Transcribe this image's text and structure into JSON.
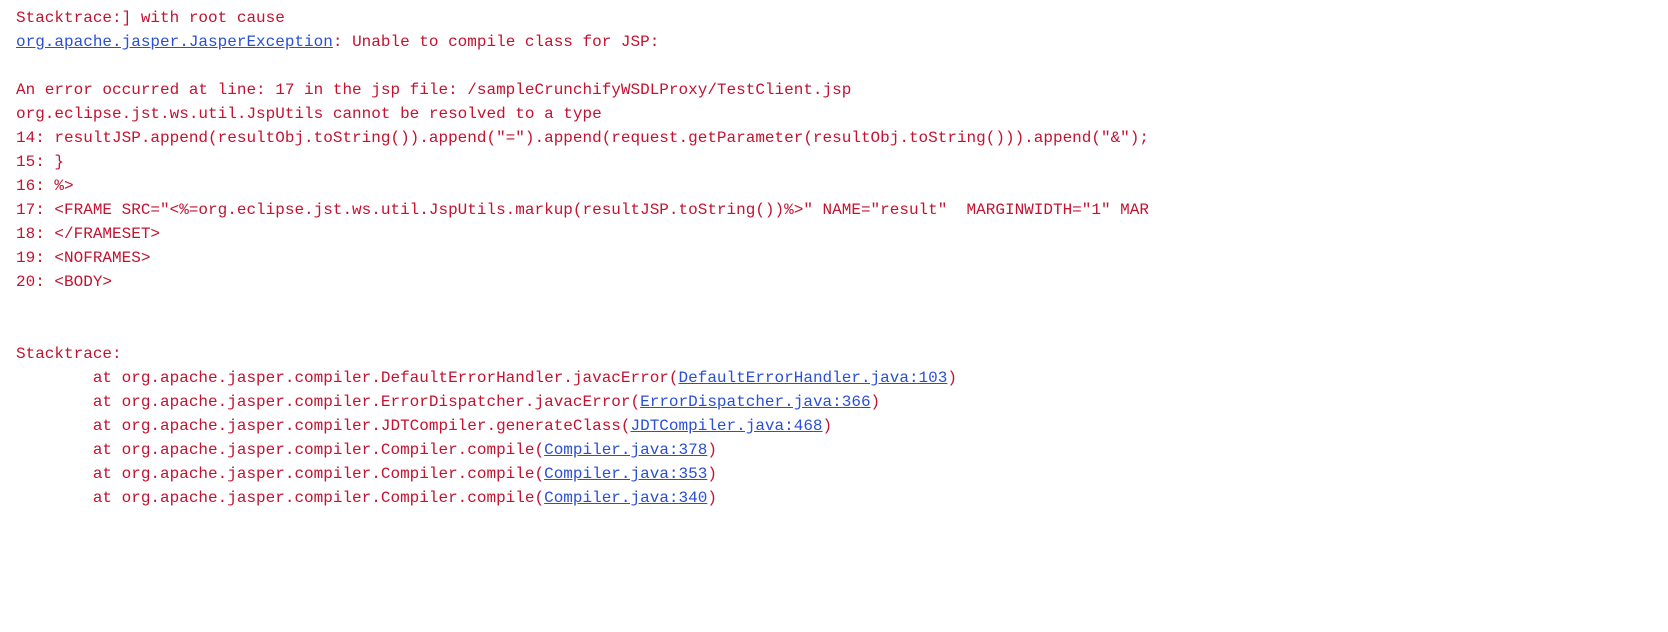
{
  "header": {
    "line1": "Stacktrace:] with root cause",
    "exception_class": "org.apache.jasper.JasperException",
    "exception_msg": ": Unable to compile class for JSP:"
  },
  "error_block": {
    "intro": "An error occurred at line: 17 in the jsp file: /sampleCrunchifyWSDLProxy/TestClient.jsp",
    "cause": "org.eclipse.jst.ws.util.JspUtils cannot be resolved to a type",
    "code_lines": [
      "14: resultJSP.append(resultObj.toString()).append(\"=\").append(request.getParameter(resultObj.toString())).append(\"&\");",
      "15: }",
      "16: %>",
      "17: <FRAME SRC=\"<%=org.eclipse.jst.ws.util.JspUtils.markup(resultJSP.toString())%>\" NAME=\"result\"  MARGINWIDTH=\"1\" MAR",
      "18: </FRAMESET>",
      "19: <NOFRAMES>",
      "20: <BODY>"
    ]
  },
  "stacktrace": {
    "label": "Stacktrace:",
    "frames": [
      {
        "prefix": "        at org.apache.jasper.compiler.DefaultErrorHandler.javacError(",
        "link": "DefaultErrorHandler.java:103",
        "suffix": ")"
      },
      {
        "prefix": "        at org.apache.jasper.compiler.ErrorDispatcher.javacError(",
        "link": "ErrorDispatcher.java:366",
        "suffix": ")"
      },
      {
        "prefix": "        at org.apache.jasper.compiler.JDTCompiler.generateClass(",
        "link": "JDTCompiler.java:468",
        "suffix": ")"
      },
      {
        "prefix": "        at org.apache.jasper.compiler.Compiler.compile(",
        "link": "Compiler.java:378",
        "suffix": ")"
      },
      {
        "prefix": "        at org.apache.jasper.compiler.Compiler.compile(",
        "link": "Compiler.java:353",
        "suffix": ")"
      },
      {
        "prefix": "        at org.apache.jasper.compiler.Compiler.compile(",
        "link": "Compiler.java:340",
        "suffix": ")"
      }
    ]
  }
}
